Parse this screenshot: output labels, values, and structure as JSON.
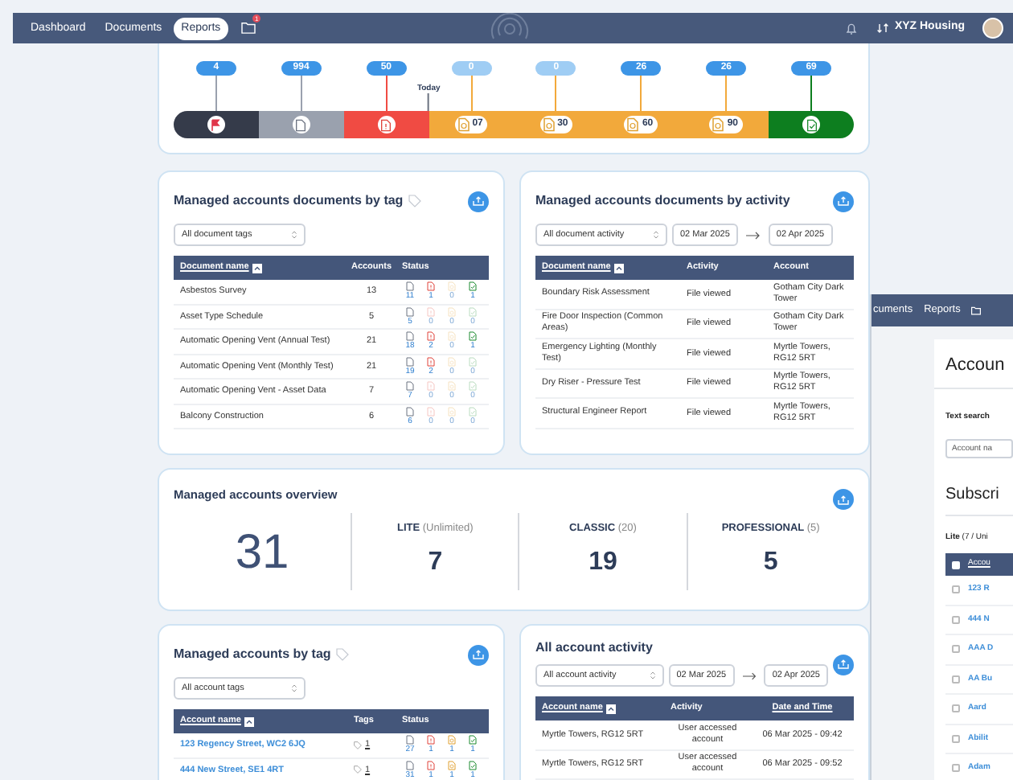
{
  "nav": {
    "items": [
      {
        "label": "Dashboard",
        "selected": false
      },
      {
        "label": "Documents",
        "selected": false
      },
      {
        "label": "Reports",
        "selected": true
      }
    ],
    "folder_badge": "1",
    "account": "XYZ Housing"
  },
  "timeline": {
    "today": "Today",
    "segments": [
      {
        "kind": "flag",
        "count": "4",
        "dimmed": false,
        "color": "#353b4a",
        "today_marker": false
      },
      {
        "kind": "doc",
        "count": "994",
        "dimmed": false,
        "color": "#9aa1ae",
        "today_marker": false
      },
      {
        "kind": "overdue",
        "count": "50",
        "dimmed": false,
        "color": "#f04b43",
        "today_marker": false
      },
      {
        "kind": "due",
        "count": "0",
        "dimmed": true,
        "color": "#f2a93b",
        "label": "07",
        "today_marker": true
      },
      {
        "kind": "due",
        "count": "0",
        "dimmed": true,
        "color": "#f2a93b",
        "label": "30",
        "today_marker": false
      },
      {
        "kind": "due",
        "count": "26",
        "dimmed": false,
        "color": "#f2a93b",
        "label": "60",
        "today_marker": false
      },
      {
        "kind": "due",
        "count": "26",
        "dimmed": false,
        "color": "#f2a93b",
        "label": "90",
        "today_marker": false
      },
      {
        "kind": "done",
        "count": "69",
        "dimmed": false,
        "color": "#0d7e1f",
        "today_marker": false
      }
    ]
  },
  "documents_by_tag": {
    "title": "Managed accounts documents by tag",
    "filter": "All document tags",
    "columns": [
      {
        "label": "Document name",
        "link": true,
        "sorted": true
      },
      {
        "label": "Accounts",
        "link": false,
        "sorted": false
      },
      {
        "label": "Status",
        "link": false,
        "sorted": false
      }
    ],
    "rows": [
      {
        "name": "Asbestos Survey",
        "accounts": "13",
        "status": [
          {
            "count": "11",
            "dimmed": false
          },
          {
            "count": "1",
            "dimmed": false
          },
          {
            "count": "0",
            "dimmed": true
          },
          {
            "count": "1",
            "dimmed": false
          }
        ]
      },
      {
        "name": "Asset Type Schedule",
        "accounts": "5",
        "status": [
          {
            "count": "5",
            "dimmed": false
          },
          {
            "count": "0",
            "dimmed": true
          },
          {
            "count": "0",
            "dimmed": true
          },
          {
            "count": "0",
            "dimmed": true
          }
        ]
      },
      {
        "name": "Automatic Opening Vent (Annual Test)",
        "accounts": "21",
        "status": [
          {
            "count": "18",
            "dimmed": false
          },
          {
            "count": "2",
            "dimmed": false
          },
          {
            "count": "0",
            "dimmed": true
          },
          {
            "count": "1",
            "dimmed": false
          }
        ]
      },
      {
        "name": "Automatic Opening Vent (Monthly Test)",
        "accounts": "21",
        "status": [
          {
            "count": "19",
            "dimmed": false
          },
          {
            "count": "2",
            "dimmed": false
          },
          {
            "count": "0",
            "dimmed": true
          },
          {
            "count": "0",
            "dimmed": true
          }
        ]
      },
      {
        "name": "Automatic Opening Vent - Asset Data",
        "accounts": "7",
        "status": [
          {
            "count": "7",
            "dimmed": false
          },
          {
            "count": "0",
            "dimmed": true
          },
          {
            "count": "0",
            "dimmed": true
          },
          {
            "count": "0",
            "dimmed": true
          }
        ]
      },
      {
        "name": "Balcony Construction",
        "accounts": "6",
        "status": [
          {
            "count": "6",
            "dimmed": false
          },
          {
            "count": "0",
            "dimmed": true
          },
          {
            "count": "0",
            "dimmed": true
          },
          {
            "count": "0",
            "dimmed": true
          }
        ]
      }
    ]
  },
  "documents_by_activity": {
    "title": "Managed accounts documents by activity",
    "filter": "All document activity",
    "date_from": "02 Mar 2025",
    "date_to": "02 Apr 2025",
    "columns": [
      {
        "label": "Document name",
        "link": true,
        "sorted": true
      },
      {
        "label": "Activity",
        "link": false,
        "sorted": false
      },
      {
        "label": "Account",
        "link": false,
        "sorted": false
      }
    ],
    "rows": [
      {
        "name": "Boundary Risk Assessment",
        "activity": "File viewed",
        "account": "Gotham City Dark Tower"
      },
      {
        "name": "Fire Door Inspection (Common Areas)",
        "activity": "File viewed",
        "account": "Gotham City Dark Tower"
      },
      {
        "name": "Emergency Lighting (Monthly Test)",
        "activity": "File viewed",
        "account": "Myrtle Towers, RG12 5RT"
      },
      {
        "name": "Dry Riser - Pressure Test",
        "activity": "File viewed",
        "account": "Myrtle Towers, RG12 5RT"
      },
      {
        "name": "Structural Engineer Report",
        "activity": "File viewed",
        "account": "Myrtle Towers, RG12 5RT"
      }
    ]
  },
  "overview": {
    "title": "Managed accounts overview",
    "total": "31",
    "tiers": [
      {
        "name": "LITE",
        "limit": "(Unlimited)",
        "value": "7"
      },
      {
        "name": "CLASSIC",
        "limit": "(20)",
        "value": "19"
      },
      {
        "name": "PROFESSIONAL",
        "limit": "(5)",
        "value": "5"
      }
    ]
  },
  "accounts_by_tag": {
    "title": "Managed accounts by tag",
    "filter": "All account tags",
    "columns": [
      {
        "label": "Account name",
        "link": true,
        "sorted": true
      },
      {
        "label": "Tags",
        "link": false,
        "sorted": false
      },
      {
        "label": "Status",
        "link": false,
        "sorted": false
      }
    ],
    "rows": [
      {
        "name": "123 Regency Street, WC2 6JQ",
        "tags": "1",
        "status": [
          {
            "count": "27",
            "dimmed": false
          },
          {
            "count": "1",
            "dimmed": false
          },
          {
            "count": "1",
            "dimmed": false
          },
          {
            "count": "1",
            "dimmed": false
          }
        ]
      },
      {
        "name": "444 New Street, SE1 4RT",
        "tags": "1",
        "status": [
          {
            "count": "31",
            "dimmed": false
          },
          {
            "count": "1",
            "dimmed": false
          },
          {
            "count": "1",
            "dimmed": false
          },
          {
            "count": "1",
            "dimmed": false
          }
        ]
      }
    ]
  },
  "account_activity": {
    "title": "All account activity",
    "filter": "All account activity",
    "date_from": "02 Mar 2025",
    "date_to": "02 Apr 2025",
    "columns": [
      {
        "label": "Account name",
        "link": true,
        "sorted": true
      },
      {
        "label": "Activity",
        "link": false,
        "sorted": false
      },
      {
        "label": "Date and Time",
        "link": true,
        "sorted": false
      }
    ],
    "rows": [
      {
        "name": "Myrtle Towers, RG12 5RT",
        "activity": "User accessed account",
        "time": "06 Mar 2025 - 09:42"
      },
      {
        "name": "Myrtle Towers, RG12 5RT",
        "activity": "User accessed account",
        "time": "06 Mar 2025 - 09:52"
      }
    ]
  },
  "second_window": {
    "nav": [
      "cuments",
      "Reports"
    ],
    "title": "Accoun",
    "search_label": "Text search",
    "search_placeholder": "Account na",
    "subtitle": "Subscri",
    "tier": "**Lite** (7 / Uni",
    "column": "Accou",
    "select_all_checked": false,
    "rows": [
      {
        "name": "123 R",
        "checked": false
      },
      {
        "name": "444 N",
        "checked": false
      },
      {
        "name": "AAA D",
        "checked": false
      },
      {
        "name": "AA Bu",
        "checked": false
      },
      {
        "name": "Aard",
        "checked": false
      },
      {
        "name": "Abilit",
        "checked": false
      },
      {
        "name": "Adam",
        "checked": false
      }
    ]
  }
}
